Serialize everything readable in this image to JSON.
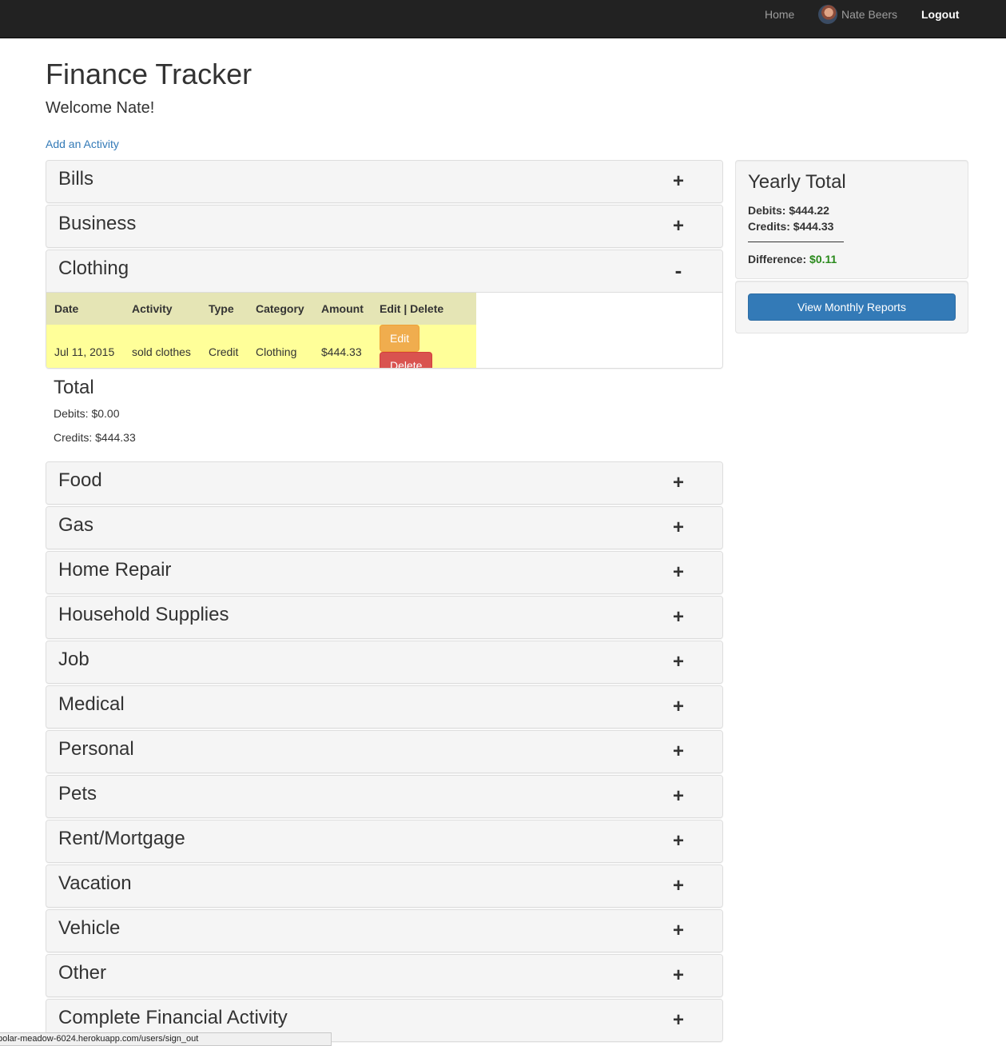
{
  "nav": {
    "home": "Home",
    "user": "Nate Beers",
    "logout": "Logout"
  },
  "header": {
    "title": "Finance Tracker",
    "welcome": "Welcome Nate!",
    "add_link": "Add an Activity"
  },
  "categories": [
    {
      "name": "Bills",
      "toggle": "+"
    },
    {
      "name": "Business",
      "toggle": "+"
    },
    {
      "name": "Clothing",
      "toggle": "-"
    },
    {
      "name": "Food",
      "toggle": "+"
    },
    {
      "name": "Gas",
      "toggle": "+"
    },
    {
      "name": "Home Repair",
      "toggle": "+"
    },
    {
      "name": "Household Supplies",
      "toggle": "+"
    },
    {
      "name": "Job",
      "toggle": "+"
    },
    {
      "name": "Medical",
      "toggle": "+"
    },
    {
      "name": "Personal",
      "toggle": "+"
    },
    {
      "name": "Pets",
      "toggle": "+"
    },
    {
      "name": "Rent/Mortgage",
      "toggle": "+"
    },
    {
      "name": "Vacation",
      "toggle": "+"
    },
    {
      "name": "Vehicle",
      "toggle": "+"
    },
    {
      "name": "Other",
      "toggle": "+"
    },
    {
      "name": "Complete Financial Activity",
      "toggle": "+"
    }
  ],
  "activity_table": {
    "headers": [
      "Date",
      "Activity",
      "Type",
      "Category",
      "Amount",
      "Edit | Delete"
    ],
    "rows": [
      {
        "date": "Jul 11, 2015",
        "activity": "sold clothes",
        "type": "Credit",
        "category": "Clothing",
        "amount": "$444.33",
        "edit": "Edit",
        "delete": "Delete"
      }
    ]
  },
  "category_total": {
    "title": "Total",
    "debits": "Debits: $0.00",
    "credits": "Credits: $444.33"
  },
  "yearly": {
    "title": "Yearly Total",
    "debits": "Debits: $444.22",
    "credits": "Credits: $444.33",
    "difference_label": "Difference:",
    "difference_value": "$0.11",
    "report_button": "View Monthly Reports"
  },
  "status_bar": "polar-meadow-6024.herokuapp.com/users/sign_out",
  "colors": {
    "navbar": "#222222",
    "link": "#337ab7",
    "edit": "#f0ad4e",
    "delete": "#d9534f",
    "difference": "#2a8a1c"
  }
}
